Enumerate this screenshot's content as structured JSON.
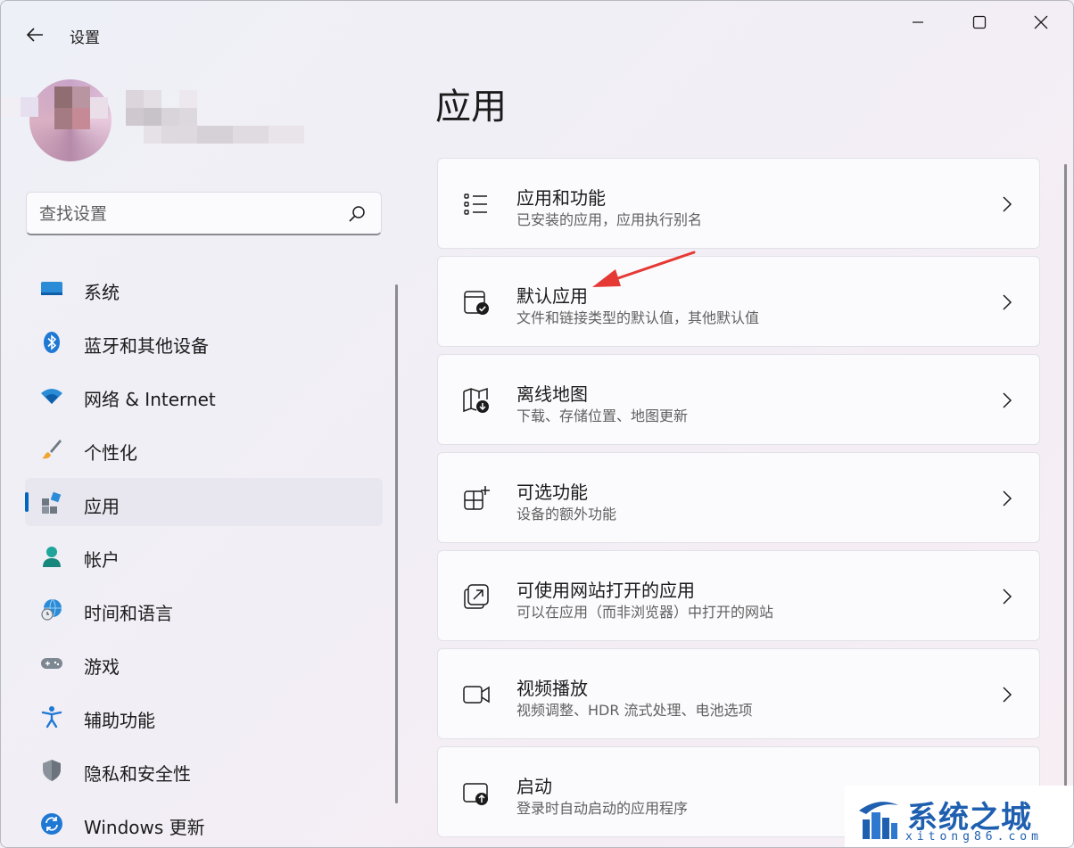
{
  "window": {
    "title": "设置"
  },
  "profile": {
    "name": ""
  },
  "search": {
    "placeholder": "查找设置",
    "value": ""
  },
  "sidebar": {
    "items": [
      {
        "label": "系统",
        "icon": "system-icon",
        "active": false
      },
      {
        "label": "蓝牙和其他设备",
        "icon": "bluetooth-icon",
        "active": false
      },
      {
        "label": "网络 & Internet",
        "icon": "wifi-icon",
        "active": false
      },
      {
        "label": "个性化",
        "icon": "brush-icon",
        "active": false
      },
      {
        "label": "应用",
        "icon": "apps-icon",
        "active": true
      },
      {
        "label": "帐户",
        "icon": "account-icon",
        "active": false
      },
      {
        "label": "时间和语言",
        "icon": "globe-clock-icon",
        "active": false
      },
      {
        "label": "游戏",
        "icon": "gamepad-icon",
        "active": false
      },
      {
        "label": "辅助功能",
        "icon": "accessibility-icon",
        "active": false
      },
      {
        "label": "隐私和安全性",
        "icon": "shield-icon",
        "active": false
      },
      {
        "label": "Windows 更新",
        "icon": "update-icon",
        "active": false
      }
    ]
  },
  "main": {
    "title": "应用",
    "cards": [
      {
        "title": "应用和功能",
        "subtitle": "已安装的应用，应用执行别名",
        "icon": "list-icon"
      },
      {
        "title": "默认应用",
        "subtitle": "文件和链接类型的默认值，其他默认值",
        "icon": "default-apps-icon"
      },
      {
        "title": "离线地图",
        "subtitle": "下载、存储位置、地图更新",
        "icon": "map-download-icon"
      },
      {
        "title": "可选功能",
        "subtitle": "设备的额外功能",
        "icon": "optional-features-icon"
      },
      {
        "title": "可使用网站打开的应用",
        "subtitle": "可以在应用（而非浏览器）中打开的网站",
        "icon": "open-external-icon"
      },
      {
        "title": "视频播放",
        "subtitle": "视频调整、HDR 流式处理、电池选项",
        "icon": "video-icon"
      },
      {
        "title": "启动",
        "subtitle": "登录时自动启动的应用程序",
        "icon": "startup-icon"
      }
    ]
  },
  "watermark": {
    "title": "系统之城",
    "url": "xitong86.com"
  },
  "colors": {
    "accent": "#0067c0",
    "annotation": "#e53935"
  }
}
